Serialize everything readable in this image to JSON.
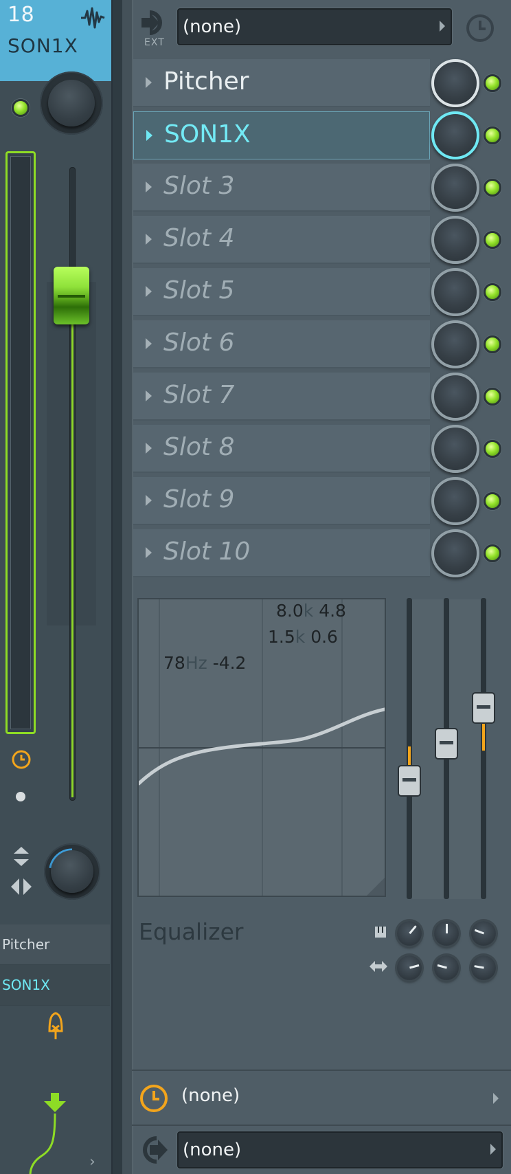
{
  "track": {
    "number": "18",
    "name": "SON1X"
  },
  "routing": {
    "ext_label": "EXT",
    "input_select": "(none)",
    "send_select": "(none)",
    "output_select": "(none)"
  },
  "slots": [
    {
      "name": "Pitcher",
      "state": "loaded"
    },
    {
      "name": "SON1X",
      "state": "active"
    },
    {
      "name": "Slot 3",
      "state": "empty"
    },
    {
      "name": "Slot 4",
      "state": "empty"
    },
    {
      "name": "Slot 5",
      "state": "empty"
    },
    {
      "name": "Slot 6",
      "state": "empty"
    },
    {
      "name": "Slot 7",
      "state": "empty"
    },
    {
      "name": "Slot 8",
      "state": "empty"
    },
    {
      "name": "Slot 9",
      "state": "empty"
    },
    {
      "name": "Slot 10",
      "state": "empty"
    }
  ],
  "mini_list": [
    {
      "name": "Pitcher"
    },
    {
      "name": "SON1X"
    }
  ],
  "equalizer": {
    "title": "Equalizer",
    "bands": [
      {
        "freq": "78",
        "unit": "Hz",
        "gain": "-4.2"
      },
      {
        "freq": "1.5",
        "unit": "k",
        "gain": "0.6"
      },
      {
        "freq": "8.0",
        "unit": "k",
        "gain": "4.8"
      }
    ]
  },
  "colors": {
    "accent_cyan": "#6fe8f3",
    "header_blue": "#57b1d6",
    "led_green": "#93e22a",
    "fader_green": "#8fe13a",
    "orange": "#f3a51c"
  }
}
